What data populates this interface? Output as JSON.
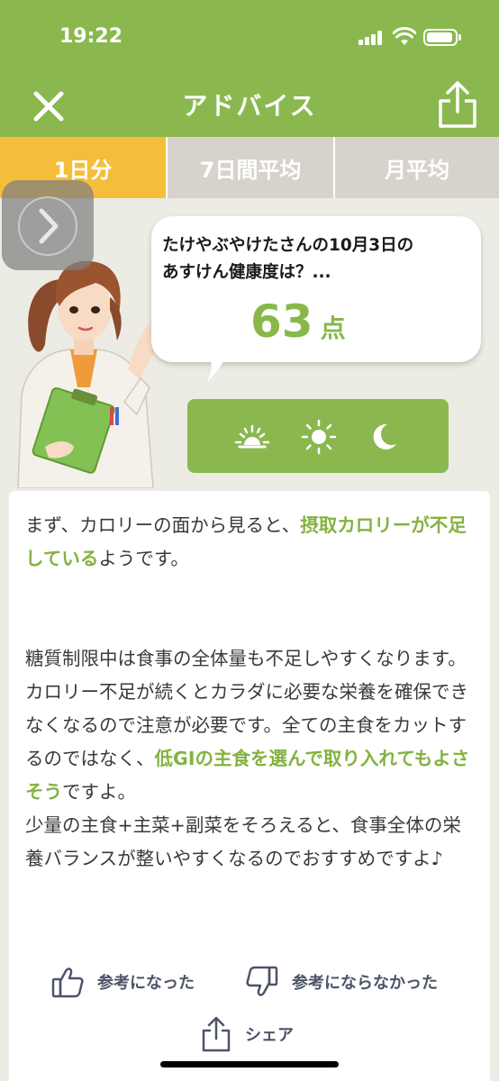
{
  "status_bar": {
    "time": "19:22"
  },
  "header": {
    "title": "アドバイス"
  },
  "tabs": [
    {
      "label": "1日分",
      "active": true
    },
    {
      "label": "7日間平均",
      "active": false
    },
    {
      "label": "月平均",
      "active": false
    }
  ],
  "bubble": {
    "line1": "たけやぶやけたさんの10月3日の",
    "line2": "あすけん健康度は？...",
    "score": "63",
    "score_unit": "点"
  },
  "time_of_day": [
    "sunrise-icon",
    "sun-icon",
    "moon-icon"
  ],
  "advice": {
    "p1_a": "まず、カロリーの面から見ると、",
    "p1_hl": "摂取カロリーが不足している",
    "p1_b": "ようです。",
    "p2_a": "糖質制限中は食事の全体量も不足しやすくなります。カロリー不足が続くとカラダに必要な栄養を確保できなくなるので注意が必要です。全ての主食をカットするのではなく、",
    "p2_hl": "低GIの主食を選んで取り入れてもよさそう",
    "p2_b": "ですよ。",
    "p3": "少量の主食+主菜+副菜をそろえると、食事全体の栄養バランスが整いやすくなるのでおすすめですよ♪"
  },
  "feedback": {
    "helpful": "参考になった",
    "not_helpful": "参考にならなかった",
    "share": "シェア"
  },
  "colors": {
    "green": "#8ab84e",
    "tab_active": "#f4be3a",
    "highlight": "#84b241"
  }
}
